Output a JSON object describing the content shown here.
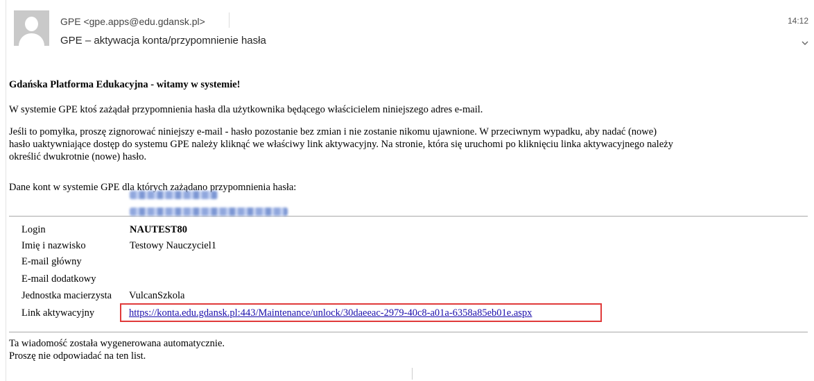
{
  "header": {
    "sender": "GPE <gpe.apps@edu.gdansk.pl>",
    "subject": "GPE – aktywacja konta/przypomnienie hasła",
    "time": "14:12"
  },
  "body": {
    "greeting": "Gdańska Platforma Edukacyjna - witamy w systemie!",
    "line1": "W systemie GPE ktoś zażądał przypomnienia hasła dla użytkownika będącego właścicielem niniejszego adres e-mail.",
    "line2a": "Jeśli to pomyłka, proszę zignorować niniejszy e-mail - hasło pozostanie bez zmian i nie zostanie nikomu ujawnione. W przeciwnym wypadku, aby nadać (nowe)",
    "line2b": "hasło uaktywniające dostęp do systemu GPE należy kliknąć we właściwy link aktywacyjny. Na stronie, która się uruchomi po kliknięciu linka aktywacyjnego należy",
    "line2c": "określić dwukrotnie (nowe) hasło.",
    "line3": "Dane kont w systemie GPE dla których zażądano przypomnienia hasła:"
  },
  "account": {
    "login_label": "Login",
    "login_value": "NAUTEST80",
    "name_label": "Imię i nazwisko",
    "name_value": "Testowy Nauczyciel1",
    "email_main_label": "E-mail główny",
    "email_extra_label": "E-mail dodatkowy",
    "unit_label": "Jednostka macierzysta",
    "unit_value": "VulcanSzkola",
    "link_label": "Link aktywacyjny",
    "link_value": "https://konta.edu.gdansk.pl:443/Maintenance/unlock/30daeeac-2979-40c8-a01a-6358a85eb01e.aspx"
  },
  "footer": {
    "line1": "Ta wiadomość została wygenerowana automatycznie.",
    "line2": "Proszę nie odpowiadać na ten list."
  },
  "icons": {
    "avatar": "person-avatar-icon",
    "expand": "chevron-down-icon"
  }
}
